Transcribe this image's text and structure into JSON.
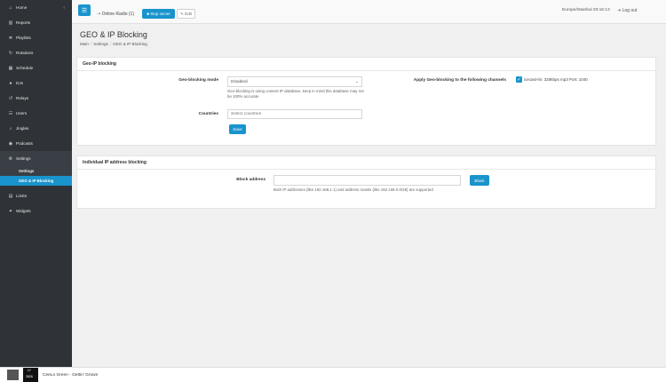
{
  "sidebar": {
    "items": [
      {
        "label": "Home",
        "icon": "home-icon",
        "glyph": "⌂",
        "arrow": "‹"
      },
      {
        "label": "Reports",
        "icon": "chart-icon",
        "glyph": "▥"
      },
      {
        "label": "Playlists",
        "icon": "list-icon",
        "glyph": "≣"
      },
      {
        "label": "Rotations",
        "icon": "rotate-icon",
        "glyph": "↻"
      },
      {
        "label": "Schedule",
        "icon": "calendar-icon",
        "glyph": "▦"
      },
      {
        "label": "DJs",
        "icon": "mic-icon",
        "glyph": "●"
      },
      {
        "label": "Relays",
        "icon": "relay-icon",
        "glyph": "↺"
      },
      {
        "label": "Users",
        "icon": "users-icon",
        "glyph": "☷"
      },
      {
        "label": "Jingles",
        "icon": "bell-icon",
        "glyph": "♪"
      },
      {
        "label": "Podcasts",
        "icon": "podcast-icon",
        "glyph": "◉"
      },
      {
        "label": "Settings",
        "icon": "sliders-icon",
        "glyph": "⚙"
      }
    ],
    "settings_sub": [
      "Settings",
      "GEO & IP Blocking"
    ],
    "bottom_items": [
      {
        "label": "Limits",
        "icon": "limits-icon",
        "glyph": "▤"
      },
      {
        "label": "Widgets",
        "icon": "widgets-icon",
        "glyph": "✦"
      }
    ]
  },
  "topbar": {
    "radio_name": "Online Radio (1)",
    "stop_label": "Stop server",
    "edit_label": "Edit",
    "timezone": "Europe/Istanbul 20:16:13",
    "logout_label": "Log out"
  },
  "page": {
    "title": "GEO & IP Blocking",
    "breadcrumb": [
      "Main",
      "Settings",
      "GEO & IP Blocking"
    ]
  },
  "geo": {
    "header": "Geo-IP blocking",
    "mode_label": "Geo-blocking mode",
    "mode_value": "Disabled",
    "mode_help": "Geo-blocking is using content IP database, keep in mind this database may not be 100% accurate",
    "countries_label": "Countries",
    "countries_placeholder": "Select countries",
    "save_label": "Save",
    "apply_label": "Apply Geo-blocking to the following channels",
    "channel": "icecast-lm: 320kbps mp3 Port: 1040"
  },
  "ip": {
    "header": "Individual IP address blocking",
    "block_label": "Block address",
    "help": "Both IP addresses (like 192.168.1.1) and address masks (like 192.168.0.0/28) are supported",
    "button_label": "Block"
  },
  "player": {
    "track": "CeeLo Green - Gettin' Grown",
    "album_text_1": "LY",
    "album_text_2": "2826"
  },
  "colors": {
    "accent": "#1994cc",
    "sidebar_bg": "#2f3338"
  }
}
